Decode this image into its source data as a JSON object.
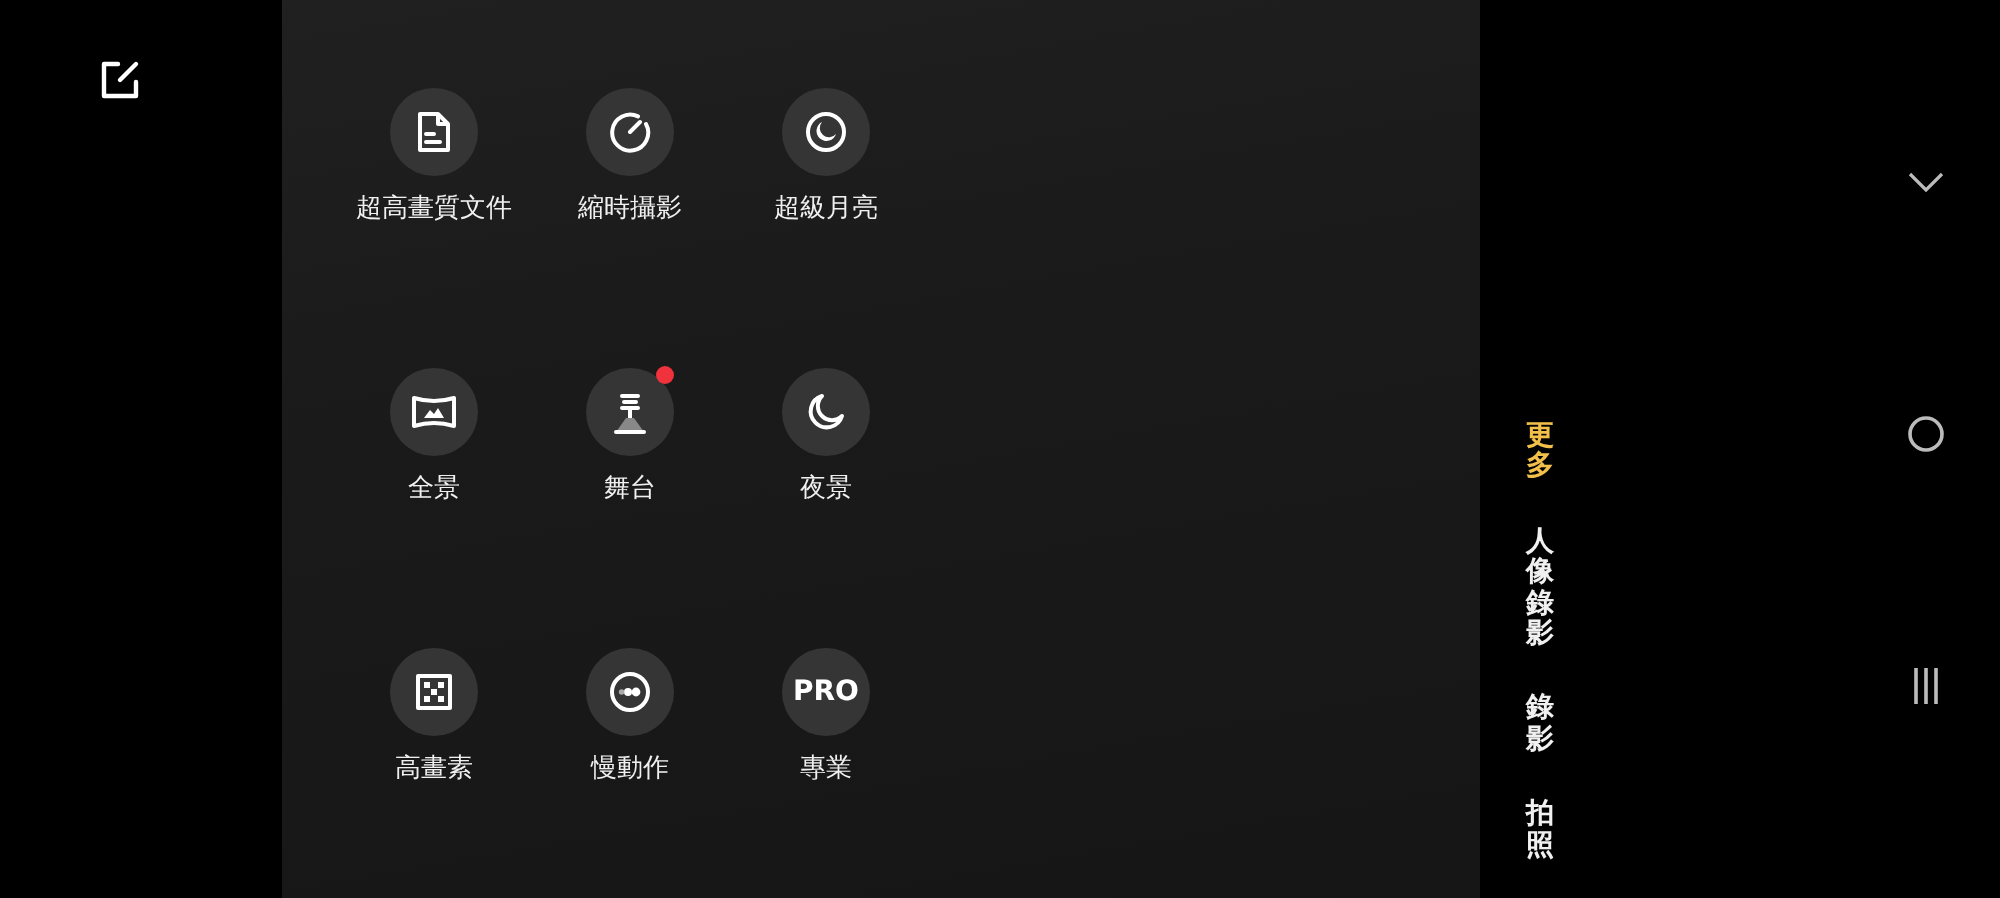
{
  "modes": [
    {
      "label": "超高畫質文件",
      "kind": "document",
      "badge": false
    },
    {
      "label": "縮時攝影",
      "kind": "timer",
      "badge": false
    },
    {
      "label": "超級月亮",
      "kind": "moon",
      "badge": false
    },
    {
      "label": "全景",
      "kind": "panorama",
      "badge": false
    },
    {
      "label": "舞台",
      "kind": "stage",
      "badge": true
    },
    {
      "label": "夜景",
      "kind": "night",
      "badge": false
    },
    {
      "label": "高畫素",
      "kind": "pixels",
      "badge": false
    },
    {
      "label": "慢動作",
      "kind": "slowmo",
      "badge": false
    },
    {
      "label": "專業",
      "kind": "text",
      "badge": false
    }
  ],
  "pro_icon_text": "PRO",
  "mode_tabs": [
    {
      "label": "更多",
      "selected": true
    },
    {
      "label": "人像錄影",
      "selected": false
    },
    {
      "label": "錄影",
      "selected": false
    },
    {
      "label": "拍照",
      "selected": false
    }
  ]
}
